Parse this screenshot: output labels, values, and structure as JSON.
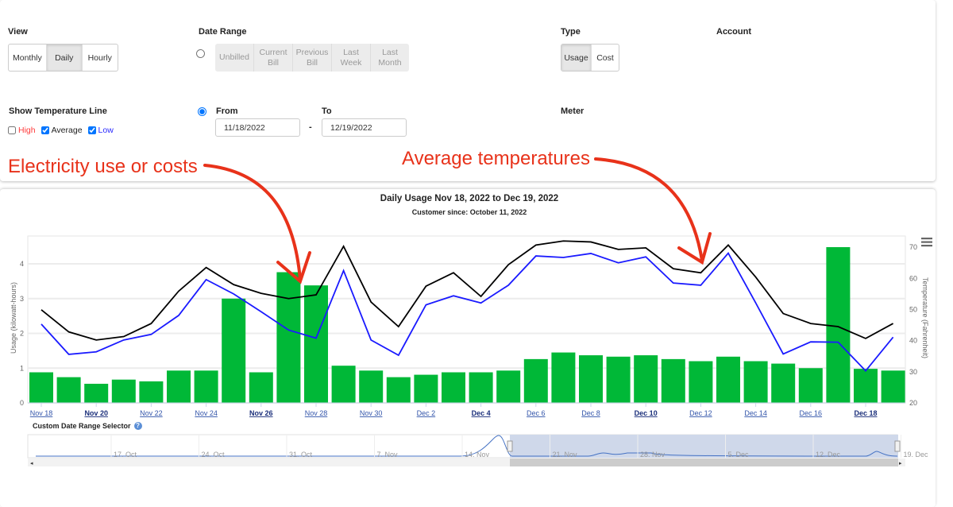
{
  "controls": {
    "view": {
      "label": "View",
      "options": [
        "Monthly",
        "Daily",
        "Hourly"
      ],
      "selected": "Daily"
    },
    "date_range": {
      "label": "Date Range",
      "options": [
        "Unbilled",
        "Current\nBill",
        "Previous\nBill",
        "Last\nWeek",
        "Last\nMonth"
      ],
      "from_label": "From",
      "to_label": "To",
      "from_value": "11/18/2022",
      "to_value": "12/19/2022",
      "separator": "-"
    },
    "type": {
      "label": "Type",
      "options": [
        "Usage",
        "Cost"
      ],
      "selected": "Usage"
    },
    "account": {
      "label": "Account"
    },
    "meter": {
      "label": "Meter"
    },
    "temperature": {
      "label": "Show Temperature Line",
      "high": "High",
      "average": "Average",
      "low": "Low",
      "high_checked": false,
      "average_checked": true,
      "low_checked": true,
      "high_color": "#ff3b3b",
      "low_color": "#2a2aff"
    }
  },
  "annotations": {
    "left": "Electricity use or costs",
    "right": "Average temperatures",
    "color": "#e8321a"
  },
  "chart_data": {
    "type": "bar",
    "title": "Daily Usage Nov 18, 2022 to Dec 19, 2022",
    "subtitle": "Customer since: October 11, 2022",
    "ylabel": "Usage (kilowatt-hours)",
    "y2label": "Temperature (Fahrenheit)",
    "ylim": [
      0,
      4.8
    ],
    "yticks": [
      0,
      1,
      2,
      3,
      4
    ],
    "y2lim": [
      20,
      73.6
    ],
    "y2ticks": [
      20,
      30,
      40,
      50,
      60,
      70
    ],
    "categories": [
      "Nov 18",
      "Nov 19",
      "Nov 20",
      "Nov 21",
      "Nov 22",
      "Nov 23",
      "Nov 24",
      "Nov 25",
      "Nov 26",
      "Nov 27",
      "Nov 28",
      "Nov 29",
      "Nov 30",
      "Dec 1",
      "Dec 2",
      "Dec 3",
      "Dec 4",
      "Dec 5",
      "Dec 6",
      "Dec 7",
      "Dec 8",
      "Dec 9",
      "Dec 10",
      "Dec 11",
      "Dec 12",
      "Dec 13",
      "Dec 14",
      "Dec 15",
      "Dec 16",
      "Dec 17",
      "Dec 18",
      "Dec 19"
    ],
    "xtick_labels": [
      "Nov 18",
      "Nov 20",
      "Nov 22",
      "Nov 24",
      "Nov 26",
      "Nov 28",
      "Nov 30",
      "Dec 2",
      "Dec 4",
      "Dec 6",
      "Dec 8",
      "Dec 10",
      "Dec 12",
      "Dec 14",
      "Dec 16",
      "Dec 18"
    ],
    "xtick_bold": [
      "Nov 20",
      "Nov 26",
      "Dec 4",
      "Dec 10",
      "Dec 18"
    ],
    "series": [
      {
        "kind": "bar",
        "axis": "usage",
        "color": "#00b837",
        "values": [
          0.88,
          0.74,
          0.55,
          0.67,
          0.62,
          0.93,
          0.93,
          3.0,
          0.88,
          3.76,
          3.38,
          1.07,
          0.93,
          0.74,
          0.81,
          0.88,
          0.88,
          0.93,
          1.26,
          1.45,
          1.37,
          1.33,
          1.37,
          1.26,
          1.2,
          1.33,
          1.2,
          1.13,
          1.0,
          4.48,
          0.98,
          0.93
        ]
      },
      {
        "kind": "line",
        "axis": "temperature",
        "color": "#000000",
        "values": [
          49.9,
          42.8,
          40.2,
          41.3,
          45.5,
          55.9,
          63.5,
          58,
          55.2,
          53.5,
          54.7,
          70.3,
          52.4,
          44.5,
          57.5,
          61.8,
          54.2,
          64.4,
          70.7,
          72,
          71.7,
          69.3,
          69.8,
          63.1,
          61.8,
          70.7,
          60.4,
          48.7,
          45.5,
          44.5,
          40.7,
          45.5
        ]
      },
      {
        "kind": "line",
        "axis": "temperature",
        "color": "#1a1aff",
        "values": [
          45.3,
          35.6,
          36.4,
          40.2,
          42,
          48.1,
          59.6,
          55,
          49.3,
          43.4,
          40.8,
          62.5,
          40.2,
          35.3,
          51.5,
          54.4,
          52.1,
          57.8,
          67.2,
          66.7,
          68,
          65,
          66.9,
          58.5,
          57.8,
          68.1,
          52.1,
          35.7,
          39.6,
          39.5,
          30.3,
          41.1
        ]
      }
    ],
    "navigator": {
      "label": "Custom Date Range Selector",
      "ticks": [
        "17. Oct",
        "24. Oct",
        "31. Oct",
        "7. Nov",
        "14. Nov",
        "21. Nov",
        "28. Nov",
        "5. Dec",
        "12. Dec",
        "19. Dec"
      ]
    },
    "icons": {
      "menu": "hamburger-menu-icon",
      "help": "help-icon"
    }
  }
}
